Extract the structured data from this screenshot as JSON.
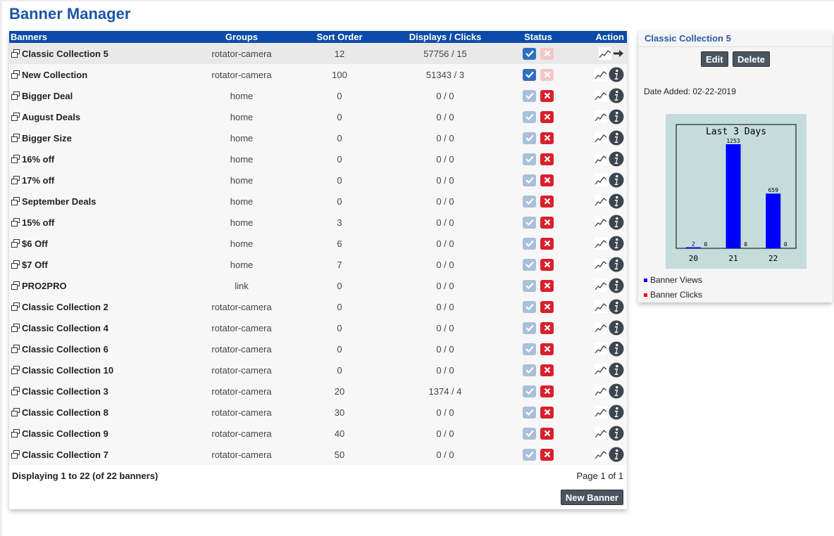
{
  "page": {
    "title": "Banner Manager"
  },
  "table": {
    "headers": {
      "banners": "Banners",
      "groups": "Groups",
      "sort_order": "Sort Order",
      "displays_clicks": "Displays / Clicks",
      "status": "Status",
      "action": "Action"
    },
    "rows": [
      {
        "name": "Classic Collection 5",
        "group": "rotator-camera",
        "sort": "12",
        "dc": "57756 / 15",
        "active": true,
        "selected": true
      },
      {
        "name": "New Collection",
        "group": "rotator-camera",
        "sort": "100",
        "dc": "51343 / 3",
        "active": true,
        "selected": false
      },
      {
        "name": "Bigger Deal",
        "group": "home",
        "sort": "0",
        "dc": "0 / 0",
        "active": false,
        "selected": false
      },
      {
        "name": "August Deals",
        "group": "home",
        "sort": "0",
        "dc": "0 / 0",
        "active": false,
        "selected": false
      },
      {
        "name": "Bigger Size",
        "group": "home",
        "sort": "0",
        "dc": "0 / 0",
        "active": false,
        "selected": false
      },
      {
        "name": "16% off",
        "group": "home",
        "sort": "0",
        "dc": "0 / 0",
        "active": false,
        "selected": false
      },
      {
        "name": "17% off",
        "group": "home",
        "sort": "0",
        "dc": "0 / 0",
        "active": false,
        "selected": false
      },
      {
        "name": "September Deals",
        "group": "home",
        "sort": "0",
        "dc": "0 / 0",
        "active": false,
        "selected": false
      },
      {
        "name": "15% off",
        "group": "home",
        "sort": "3",
        "dc": "0 / 0",
        "active": false,
        "selected": false
      },
      {
        "name": "$6 Off",
        "group": "home",
        "sort": "6",
        "dc": "0 / 0",
        "active": false,
        "selected": false
      },
      {
        "name": "$7 Off",
        "group": "home",
        "sort": "7",
        "dc": "0 / 0",
        "active": false,
        "selected": false
      },
      {
        "name": "PRO2PRO",
        "group": "link",
        "sort": "0",
        "dc": "0 / 0",
        "active": false,
        "selected": false
      },
      {
        "name": "Classic Collection 2",
        "group": "rotator-camera",
        "sort": "0",
        "dc": "0 / 0",
        "active": false,
        "selected": false
      },
      {
        "name": "Classic Collection 4",
        "group": "rotator-camera",
        "sort": "0",
        "dc": "0 / 0",
        "active": false,
        "selected": false
      },
      {
        "name": "Classic Collection 6",
        "group": "rotator-camera",
        "sort": "0",
        "dc": "0 / 0",
        "active": false,
        "selected": false
      },
      {
        "name": "Classic Collection 10",
        "group": "rotator-camera",
        "sort": "0",
        "dc": "0 / 0",
        "active": false,
        "selected": false
      },
      {
        "name": "Classic Collection 3",
        "group": "rotator-camera",
        "sort": "20",
        "dc": "1374 / 4",
        "active": false,
        "selected": false
      },
      {
        "name": "Classic Collection 8",
        "group": "rotator-camera",
        "sort": "30",
        "dc": "0 / 0",
        "active": false,
        "selected": false
      },
      {
        "name": "Classic Collection 9",
        "group": "rotator-camera",
        "sort": "40",
        "dc": "0 / 0",
        "active": false,
        "selected": false
      },
      {
        "name": "Classic Collection 7",
        "group": "rotator-camera",
        "sort": "50",
        "dc": "0 / 0",
        "active": false,
        "selected": false
      }
    ]
  },
  "footer": {
    "displaying": "Displaying 1 to 22 (of 22 banners)",
    "page": "Page 1 of 1",
    "new_banner": "New Banner"
  },
  "side": {
    "title": "Classic Collection 5",
    "edit": "Edit",
    "delete": "Delete",
    "date_added": "Date Added: 02-22-2019",
    "legend": [
      {
        "label": "Banner Views",
        "color": "#0000ff"
      },
      {
        "label": "Banner Clicks",
        "color": "#ff0000"
      }
    ]
  },
  "colors": {
    "title_blue": "#1a56a6",
    "header_blue": "#0b4aa8",
    "check_active": "#2f6fc0",
    "check_inactive": "#a9bfda",
    "x_active": "#d9202b",
    "x_inactive": "#f2c7c9",
    "chart_bg": "#c5dcdc",
    "bar": "#0000ff"
  },
  "chart_data": {
    "type": "bar",
    "title": "Last 3 Days",
    "categories": [
      "20",
      "21",
      "22"
    ],
    "series": [
      {
        "name": "Banner Views",
        "values": [
          2,
          1253,
          659
        ],
        "color": "#0000ff"
      },
      {
        "name": "Banner Clicks",
        "values": [
          0,
          0,
          0
        ],
        "color": "#ff0000"
      }
    ],
    "ylim": [
      0,
      1253
    ],
    "grid": false,
    "legend": "bottom"
  }
}
